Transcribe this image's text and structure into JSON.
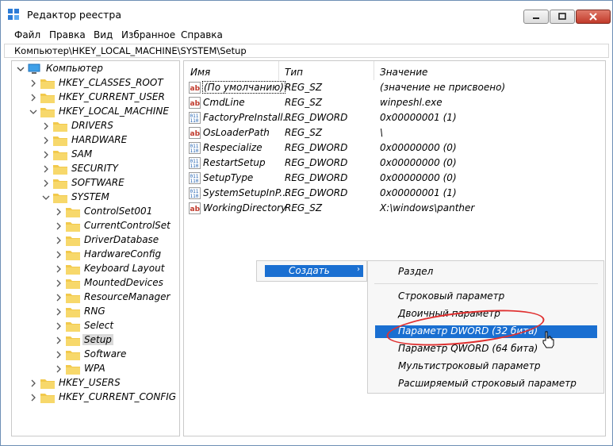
{
  "window": {
    "title": "Редактор реестра"
  },
  "menu": [
    "Файл",
    "Правка",
    "Вид",
    "Избранное",
    "Справка"
  ],
  "address": "Компьютер\\HKEY_LOCAL_MACHINE\\SYSTEM\\Setup",
  "tree": {
    "root": "Компьютер",
    "hives": [
      "HKEY_CLASSES_ROOT",
      "HKEY_CURRENT_USER",
      "HKEY_LOCAL_MACHINE"
    ],
    "hklm_children": [
      "DRIVERS",
      "HARDWARE",
      "SAM",
      "SECURITY",
      "SOFTWARE",
      "SYSTEM"
    ],
    "system_children": [
      "ControlSet001",
      "CurrentControlSet",
      "DriverDatabase",
      "HardwareConfig",
      "Keyboard Layout",
      "MountedDevices",
      "ResourceManager",
      "RNG",
      "Select",
      "Setup",
      "Software",
      "WPA"
    ],
    "hives_after": [
      "HKEY_USERS",
      "HKEY_CURRENT_CONFIG"
    ],
    "selected": "Setup"
  },
  "list": {
    "columns": {
      "name": "Имя",
      "type": "Тип",
      "value": "Значение"
    },
    "rows": [
      {
        "name": "(По умолчанию)",
        "type": "REG_SZ",
        "value": "(значение не присвоено)",
        "icon": "string-value-icon"
      },
      {
        "name": "CmdLine",
        "type": "REG_SZ",
        "value": "winpeshl.exe",
        "icon": "string-value-icon"
      },
      {
        "name": "FactoryPreInstall...",
        "type": "REG_DWORD",
        "value": "0x00000001 (1)",
        "icon": "binary-value-icon"
      },
      {
        "name": "OsLoaderPath",
        "type": "REG_SZ",
        "value": "\\",
        "icon": "string-value-icon"
      },
      {
        "name": "Respecialize",
        "type": "REG_DWORD",
        "value": "0x00000000 (0)",
        "icon": "binary-value-icon"
      },
      {
        "name": "RestartSetup",
        "type": "REG_DWORD",
        "value": "0x00000000 (0)",
        "icon": "binary-value-icon"
      },
      {
        "name": "SetupType",
        "type": "REG_DWORD",
        "value": "0x00000000 (0)",
        "icon": "binary-value-icon"
      },
      {
        "name": "SystemSetupInP...",
        "type": "REG_DWORD",
        "value": "0x00000001 (1)",
        "icon": "binary-value-icon"
      },
      {
        "name": "WorkingDirectory",
        "type": "REG_SZ",
        "value": "X:\\windows\\panther",
        "icon": "string-value-icon"
      }
    ]
  },
  "context_menu": {
    "create_label": "Создать",
    "arrow": "›"
  },
  "submenu": {
    "items": [
      "Раздел",
      "Строковый параметр",
      "Двоичный параметр",
      "Параметр DWORD (32 бита)",
      "Параметр QWORD (64 бита)",
      "Мультистроковый параметр",
      "Расширяемый строковый параметр"
    ],
    "highlighted": "Параметр DWORD (32 бита)"
  },
  "colors": {
    "accent": "#1a6fd1",
    "folder": "#f2c94c",
    "annotation": "#e03030"
  }
}
